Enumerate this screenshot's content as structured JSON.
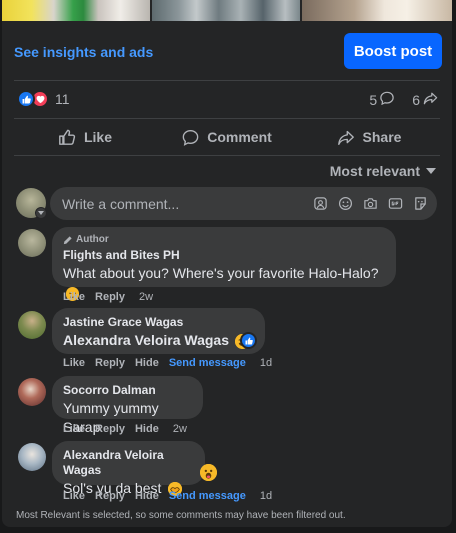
{
  "header": {
    "insights_link": "See insights and ads",
    "boost_button": "Boost post"
  },
  "reactions": {
    "count": "11",
    "comments_count": "5",
    "shares_count": "6"
  },
  "actions": {
    "like": "Like",
    "comment": "Comment",
    "share": "Share"
  },
  "sort": {
    "label": "Most relevant"
  },
  "composer": {
    "placeholder": "Write a comment..."
  },
  "comments": [
    {
      "badge": "Author",
      "author": "Flights and Bites PH",
      "text": "What about you? Where's your favorite Halo-Halo?",
      "like": "Like",
      "reply": "Reply",
      "time": "2w"
    },
    {
      "author": "Jastine Grace Wagas",
      "text": "Alexandra Veloira Wagas",
      "like": "Like",
      "reply": "Reply",
      "hide": "Hide",
      "send": "Send message",
      "time": "1d"
    },
    {
      "author": "Socorro Dalman",
      "text": "Yummy yummy Sarap",
      "like": "Like",
      "reply": "Reply",
      "hide": "Hide",
      "time": "2w"
    },
    {
      "author": "Alexandra Veloira Wagas",
      "text": "Sol's yu da best",
      "like": "Like",
      "reply": "Reply",
      "hide": "Hide",
      "send": "Send message",
      "time": "1d"
    }
  ],
  "footer": {
    "note": "Most Relevant is selected, so some comments may have been filtered out."
  },
  "colors": {
    "background": "#242526",
    "accent": "#0866ff",
    "link": "#4599ff",
    "bubble": "#3a3b3c"
  }
}
